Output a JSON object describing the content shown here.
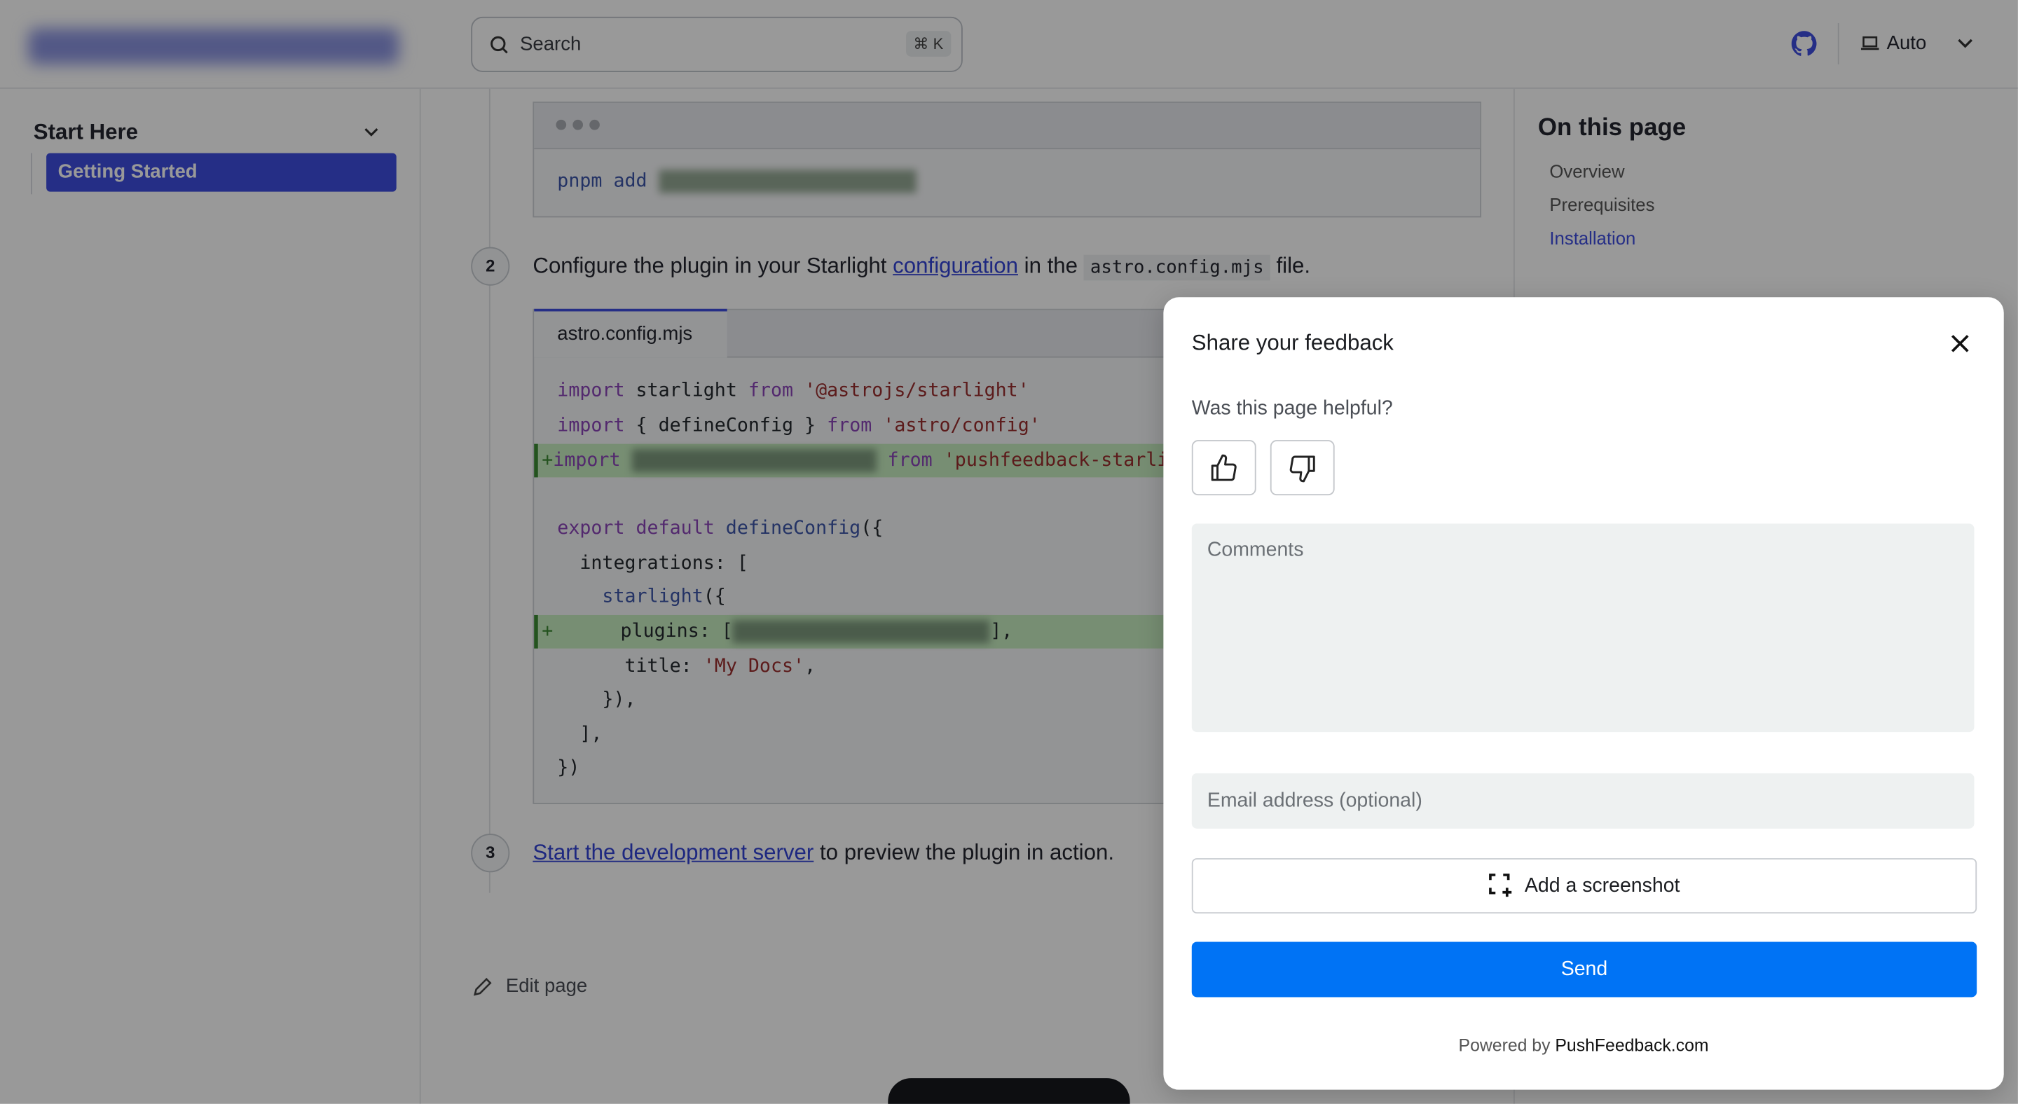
{
  "header": {
    "logo_text": "pushfeedback-starlight",
    "search_placeholder": "Search",
    "search_shortcut": "⌘ K",
    "theme_label": "Auto"
  },
  "sidebar": {
    "group": "Start Here",
    "items": [
      {
        "label": "Getting Started",
        "active": true
      }
    ]
  },
  "content": {
    "install_cmd": "pnpm add",
    "step2_num": "2",
    "step2_pre": "Configure the plugin in your Starlight ",
    "step2_link": "configuration",
    "step2_mid": " in the ",
    "step2_code": "astro.config.mjs",
    "step2_post": " file.",
    "code_tab": "astro.config.mjs",
    "step3_num": "3",
    "step3_link": "Start the development server",
    "step3_post": " to preview the plugin in action.",
    "edit_page": "Edit page"
  },
  "code_lines": {
    "l1": [
      "import",
      " starlight ",
      "from",
      " '@astrojs/starlight'"
    ],
    "l2": [
      "import",
      " { defineConfig } ",
      "from",
      " 'astro/config'"
    ],
    "l3": [
      "+",
      "import",
      "from",
      " 'pushfeedback-starlight'"
    ],
    "l5": [
      "export default",
      " defineConfig",
      "({"
    ],
    "l6": "  integrations: [",
    "l7": [
      "    ",
      "starlight",
      "({"
    ],
    "l8": [
      "+",
      "      plugins: [",
      "],"
    ],
    "l9": [
      "      title: ",
      "'My Docs'",
      ","
    ],
    "l10": "    }),",
    "l11": "  ],",
    "l12": "})"
  },
  "toc": {
    "title": "On this page",
    "items": [
      {
        "label": "Overview"
      },
      {
        "label": "Prerequisites"
      },
      {
        "label": "Installation",
        "active": true
      }
    ]
  },
  "modal": {
    "title": "Share your feedback",
    "question": "Was this page helpful?",
    "comments_placeholder": "Comments",
    "email_placeholder": "Email address (optional)",
    "screenshot_label": "Add a screenshot",
    "send_label": "Send",
    "powered_prefix": "Powered by ",
    "powered_brand": "PushFeedback.com"
  },
  "colors": {
    "accent": "#3f4ddf",
    "send": "#0073f5",
    "link": "#3243d6"
  }
}
